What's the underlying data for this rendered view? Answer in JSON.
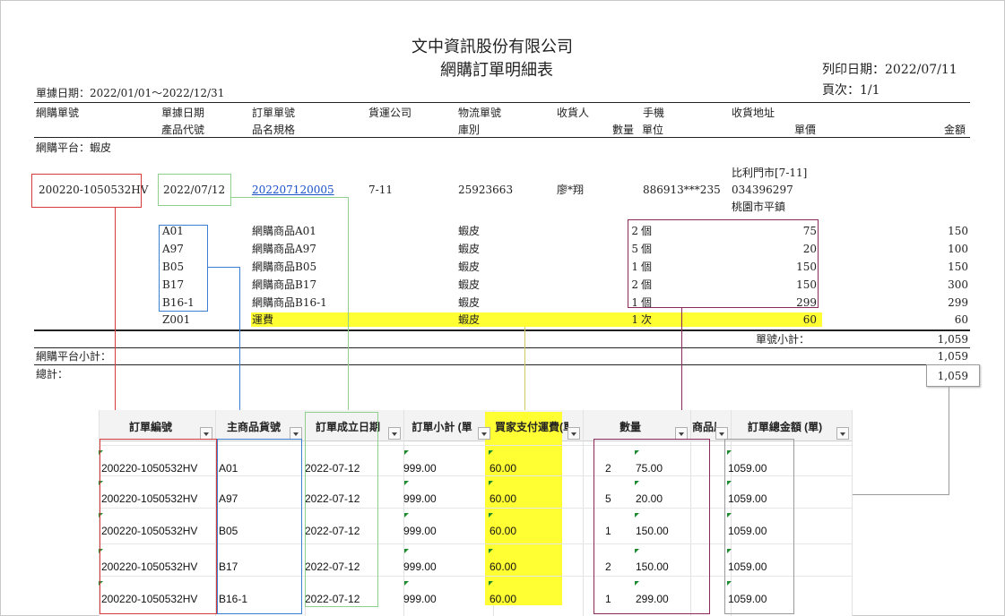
{
  "report": {
    "company": "文中資訊股份有限公司",
    "title": "網購訂單明細表",
    "print_date": "列印日期：2022/07/11",
    "page": "頁次：1/1",
    "date_range": "單據日期：2022/01/01～2022/12/31",
    "headers_row1": [
      "網購單號",
      "單據日期",
      "訂單單號",
      "貨運公司",
      "物流單號",
      "收貨人",
      "手機",
      "收貨地址"
    ],
    "headers_row2": [
      "產品代號",
      "品名規格",
      "庫別",
      "數量",
      "單位",
      "單價",
      "金額"
    ],
    "platform": "網購平台：蝦皮",
    "order": {
      "no": "200220-1050532HV",
      "date": "2022/07/12",
      "order_no": "202207120005",
      "carrier": "7-11",
      "logistics_no": "25923663",
      "receiver": "廖*翔",
      "phone": "886913***235",
      "address1": "比利門市[7-11]",
      "address2": "034396297",
      "address3": "桃園市平鎮"
    },
    "items": [
      {
        "code": "A01",
        "name": "網購商品A01",
        "store": "蝦皮",
        "qty": "2",
        "unit": "個",
        "price": "75",
        "amount": "150"
      },
      {
        "code": "A97",
        "name": "網購商品A97",
        "store": "蝦皮",
        "qty": "5",
        "unit": "個",
        "price": "20",
        "amount": "100"
      },
      {
        "code": "B05",
        "name": "網購商品B05",
        "store": "蝦皮",
        "qty": "1",
        "unit": "個",
        "price": "150",
        "amount": "150"
      },
      {
        "code": "B17",
        "name": "網購商品B17",
        "store": "蝦皮",
        "qty": "2",
        "unit": "個",
        "price": "150",
        "amount": "300"
      },
      {
        "code": "B16-1",
        "name": "網購商品B16-1",
        "store": "蝦皮",
        "qty": "1",
        "unit": "個",
        "price": "299",
        "amount": "299"
      },
      {
        "code": "Z001",
        "name": "運費",
        "store": "蝦皮",
        "qty": "1",
        "unit": "次",
        "price": "60",
        "amount": "60"
      }
    ],
    "order_subtotal_label": "單號小計：",
    "order_subtotal": "1,059",
    "platform_subtotal_label": "網購平台小計：",
    "platform_subtotal": "1,059",
    "total_label": "總計：",
    "total": "1,059"
  },
  "sheet": {
    "headers": [
      "訂單編號",
      "主商品貨號",
      "訂單成立日期",
      "訂單小計 (單",
      "買家支付運費(單",
      "數量",
      "商品原價 (品",
      "訂單總金額 (單)"
    ],
    "rows": [
      [
        "200220-1050532HV",
        "A01",
        "2022-07-12",
        "999.00",
        "60.00",
        "2",
        "75.00",
        "1059.00"
      ],
      [
        "200220-1050532HV",
        "A97",
        "2022-07-12",
        "999.00",
        "60.00",
        "5",
        "20.00",
        "1059.00"
      ],
      [
        "200220-1050532HV",
        "B05",
        "2022-07-12",
        "999.00",
        "60.00",
        "1",
        "150.00",
        "1059.00"
      ],
      [
        "200220-1050532HV",
        "B17",
        "2022-07-12",
        "999.00",
        "60.00",
        "2",
        "150.00",
        "1059.00"
      ],
      [
        "200220-1050532HV",
        "B16-1",
        "2022-07-12",
        "999.00",
        "60.00",
        "1",
        "299.00",
        "1059.00"
      ]
    ]
  },
  "colors": {
    "red": "#d73a3a",
    "green": "#8fd08f",
    "blue": "#3b7fd0",
    "purple": "#8b2a5a",
    "gray": "#9a9a9a",
    "highlight": "#ffff33"
  }
}
